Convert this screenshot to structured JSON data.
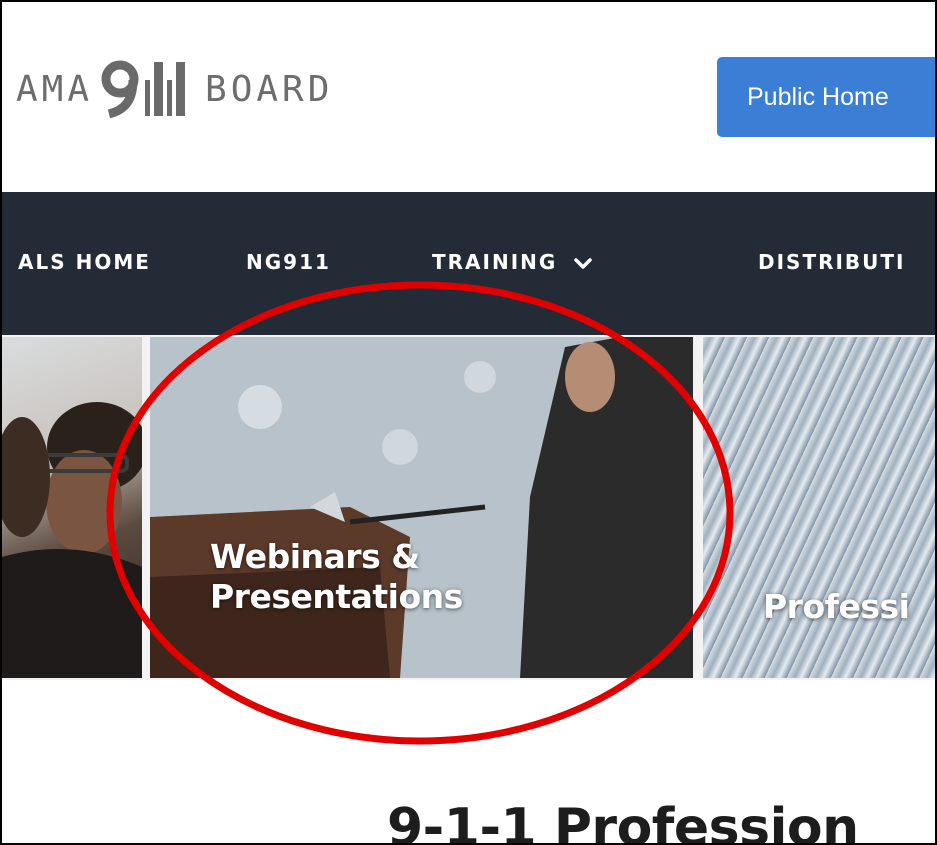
{
  "header": {
    "logo": {
      "prefix": "AMA",
      "nines": "911",
      "suffix": "BOARD"
    },
    "public_home_button": "Public Home"
  },
  "nav": {
    "items": [
      {
        "label": "ALS HOME"
      },
      {
        "label": "NG911"
      },
      {
        "label": "TRAINING"
      },
      {
        "label": "DISTRIBUTI"
      }
    ]
  },
  "cards": [
    {
      "label": ""
    },
    {
      "label_line1": "Webinars &",
      "label_line2": "Presentations"
    },
    {
      "label": "Professi"
    }
  ],
  "page": {
    "heading": "9-1-1 Profession"
  },
  "annotation": {
    "color": "#e10000"
  },
  "colors": {
    "nav_bg": "#232b36",
    "button_bg": "#3a7fd5"
  }
}
